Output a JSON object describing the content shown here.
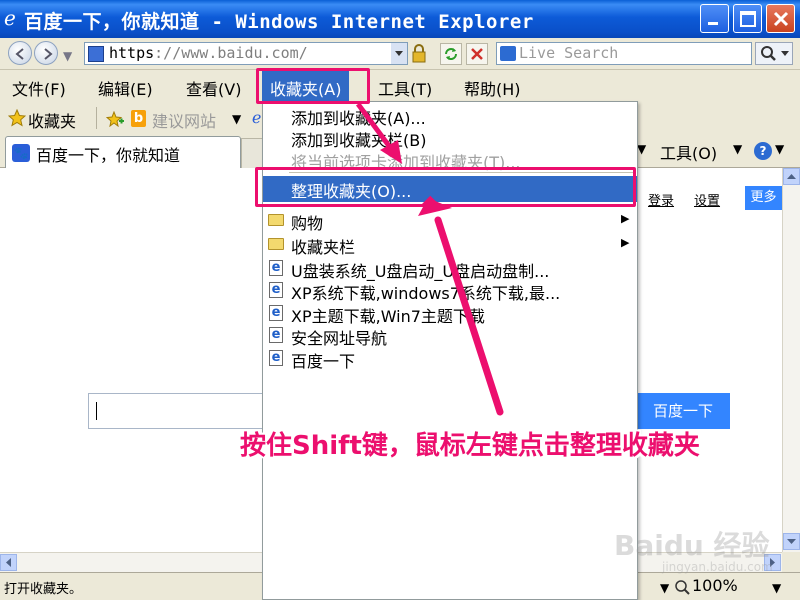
{
  "window": {
    "title": "百度一下，你就知道 - Windows Internet Explorer",
    "minimize_icon": "minimize-icon",
    "maximize_icon": "maximize-icon",
    "close_icon": "close-icon"
  },
  "address_bar": {
    "url_scheme": "https",
    "url_rest": "://www.baidu.com/",
    "search_placeholder": "Live Search"
  },
  "menubar": {
    "items": [
      "文件(F)",
      "编辑(E)",
      "查看(V)",
      "收藏夹(A)",
      "工具(T)",
      "帮助(H)"
    ],
    "open_index": 3
  },
  "linksbar": {
    "favorites_label": "收藏夹",
    "suggested_sites": "建议网站"
  },
  "tabs": {
    "active_label": "百度一下，你就知道",
    "tools_label": "工具(O)"
  },
  "content": {
    "login_link": "登录",
    "settings_link": "设置",
    "more_button": "更多",
    "search_button": "百度一下"
  },
  "favorites_menu": {
    "items": [
      {
        "label": "添加到收藏夹(A)...",
        "type": "command"
      },
      {
        "label": "添加到收藏夹栏(B)",
        "type": "command"
      },
      {
        "label": "将当前选项卡添加到收藏夹(T)...",
        "type": "command",
        "disabled": true
      },
      {
        "label": "整理收藏夹(O)...",
        "type": "command",
        "selected": true
      },
      {
        "label": "购物",
        "type": "folder"
      },
      {
        "label": "收藏夹栏",
        "type": "folder"
      },
      {
        "label": "U盘装系统_U盘启动_U盘启动盘制...",
        "type": "link"
      },
      {
        "label": "XP系统下载,windows7系统下载,最...",
        "type": "link"
      },
      {
        "label": "XP主题下载,Win7主题下载",
        "type": "link"
      },
      {
        "label": "安全网址导航",
        "type": "link"
      },
      {
        "label": "百度一下",
        "type": "link"
      }
    ]
  },
  "statusbar": {
    "text": "打开收藏夹。",
    "zoom": "100%"
  },
  "annotation": {
    "text": "按住Shift键，鼠标左键点击整理收藏夹",
    "color": "#ec0f6e"
  },
  "watermark": {
    "brand": "Baidu 经验",
    "url": "jingyan.baidu.com"
  },
  "colors": {
    "titlebar": "#0a4fc8",
    "menu_highlight": "#316ac5",
    "baidu_blue": "#3385ff"
  }
}
